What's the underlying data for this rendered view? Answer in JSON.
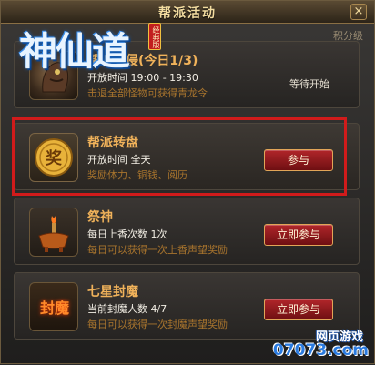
{
  "window": {
    "title": "帮派活动",
    "close_label": "×",
    "subheader": "积分级"
  },
  "logo": {
    "text": "神仙道",
    "badge": "经典版"
  },
  "activities": [
    {
      "title": "帮派入侵(今日1/3)",
      "line1": "开放时间 19:00 - 19:30",
      "line2": "击退全部怪物可获得青龙令",
      "status": "等待开始",
      "icon": "monster-portrait-icon"
    },
    {
      "title": "帮派转盘",
      "line1": "开放时间 全天",
      "line2": "奖励体力、铜钱、阅历",
      "button": "参与",
      "icon": "gold-coin-icon",
      "icon_char": "奖"
    },
    {
      "title": "祭神",
      "line1": "每日上香次数 1次",
      "line2": "每日可以获得一次上香声望奖励",
      "button": "立即参与",
      "icon": "incense-burner-icon"
    },
    {
      "title": "七星封魔",
      "line1": "当前封魔人数 4/7",
      "line2": "每日可以获得一次封魔声望奖励",
      "button": "立即参与",
      "icon": "seal-demon-icon",
      "icon_char": "封魔"
    }
  ],
  "watermark": {
    "top": "网页游戏",
    "bottom": "07073.com"
  },
  "colors": {
    "title": "#f0b25a",
    "highlight": "#d11b1b",
    "button": "#b1262a"
  }
}
